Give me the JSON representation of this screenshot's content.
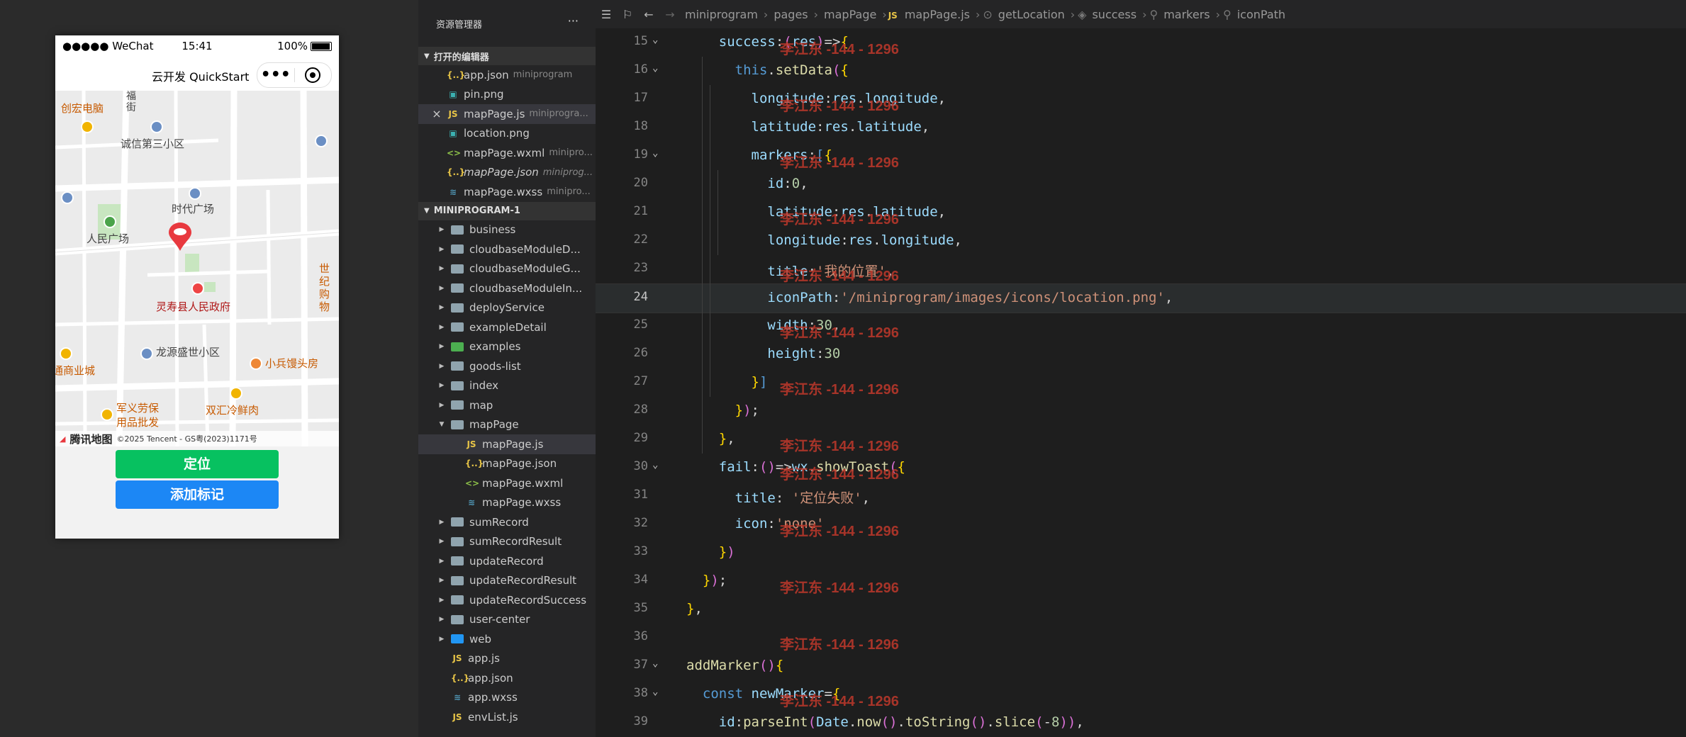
{
  "simulator": {
    "status": {
      "signal": "●●●●● WeChat",
      "time": "15:41",
      "battery": "100%"
    },
    "nav_title": "云开发 QuickStart",
    "capsule_menu": "•••",
    "map": {
      "labels": [
        "创宏电脑",
        "福街",
        "诚信第三小区",
        "时代广场",
        "人民广场",
        "灵寿县人民政府",
        "世纪购物",
        "龙源盛世小区",
        "小兵馒头房",
        "通商业城",
        "军义劳保用品批发",
        "双汇冷鲜肉"
      ],
      "provider": "腾讯地图",
      "copyright": "©2025 Tencent - GS粤(2023)1171号"
    },
    "buttons": {
      "locate": "定位",
      "add_marker": "添加标记"
    }
  },
  "explorer": {
    "title": "资源管理器",
    "more": "···",
    "open_editors_header": "打开的编辑器",
    "open_editors": [
      {
        "icon": "{..}",
        "kind": "json",
        "name": "app.json",
        "hint": "miniprogram"
      },
      {
        "icon": "▣",
        "kind": "png",
        "name": "pin.png",
        "hint": ""
      },
      {
        "icon": "JS",
        "kind": "js",
        "name": "mapPage.js",
        "hint": "miniprogra..."
      },
      {
        "icon": "▣",
        "kind": "png",
        "name": "location.png",
        "hint": ""
      },
      {
        "icon": "<>",
        "kind": "wxml",
        "name": "mapPage.wxml",
        "hint": "minipro..."
      },
      {
        "icon": "{..}",
        "kind": "json",
        "name": "mapPage.json",
        "hint": "miniprog..."
      },
      {
        "icon": "≋",
        "kind": "wxss",
        "name": "mapPage.wxss",
        "hint": "minipro..."
      }
    ],
    "project_header": "MINIPROGRAM-1",
    "tree": [
      {
        "type": "folder",
        "name": "business"
      },
      {
        "type": "folder",
        "name": "cloudbaseModuleD..."
      },
      {
        "type": "folder",
        "name": "cloudbaseModuleG..."
      },
      {
        "type": "folder",
        "name": "cloudbaseModuleIn..."
      },
      {
        "type": "folder",
        "name": "deployService"
      },
      {
        "type": "folder",
        "name": "exampleDetail"
      },
      {
        "type": "folder",
        "name": "examples"
      },
      {
        "type": "folder",
        "name": "goods-list"
      },
      {
        "type": "folder",
        "name": "index"
      },
      {
        "type": "folder",
        "name": "map"
      },
      {
        "type": "folder",
        "name": "mapPage"
      },
      {
        "type": "file",
        "icon": "JS",
        "kind": "js",
        "name": "mapPage.js"
      },
      {
        "type": "file",
        "icon": "{..}",
        "kind": "json",
        "name": "mapPage.json"
      },
      {
        "type": "file",
        "icon": "<>",
        "kind": "wxml",
        "name": "mapPage.wxml"
      },
      {
        "type": "file",
        "icon": "≋",
        "kind": "wxss",
        "name": "mapPage.wxss"
      },
      {
        "type": "folder",
        "name": "sumRecord"
      },
      {
        "type": "folder",
        "name": "sumRecordResult"
      },
      {
        "type": "folder",
        "name": "updateRecord"
      },
      {
        "type": "folder",
        "name": "updateRecordResult"
      },
      {
        "type": "folder",
        "name": "updateRecordSuccess"
      },
      {
        "type": "folder",
        "name": "user-center"
      },
      {
        "type": "folder",
        "name": "web"
      },
      {
        "type": "file",
        "icon": "JS",
        "kind": "js",
        "name": "app.js"
      },
      {
        "type": "file",
        "icon": "{..}",
        "kind": "json",
        "name": "app.json"
      },
      {
        "type": "file",
        "icon": "≋",
        "kind": "wxss",
        "name": "app.wxss"
      },
      {
        "type": "file",
        "icon": "JS",
        "kind": "js",
        "name": "envList.js"
      }
    ]
  },
  "editor": {
    "breadcrumb": [
      "miniprogram",
      "pages",
      "mapPage",
      "mapPage.js",
      "getLocation",
      "success",
      "markers",
      "iconPath"
    ],
    "watermark": "李江东 -144 - 1296",
    "current_line": 24,
    "lines": [
      {
        "n": 15,
        "code": "    success:(res)=>{"
      },
      {
        "n": 16,
        "code": "      this.setData({"
      },
      {
        "n": 17,
        "code": "        longitude:res.longitude,"
      },
      {
        "n": 18,
        "code": "        latitude:res.latitude,"
      },
      {
        "n": 19,
        "code": "        markers:[{"
      },
      {
        "n": 20,
        "code": "          id:0,"
      },
      {
        "n": 21,
        "code": "          latitude:res.latitude,"
      },
      {
        "n": 22,
        "code": "          longitude:res.longitude,"
      },
      {
        "n": 23,
        "code": "          title:'我的位置',"
      },
      {
        "n": 24,
        "code": "          iconPath:'/miniprogram/images/icons/location.png',"
      },
      {
        "n": 25,
        "code": "          width:30,"
      },
      {
        "n": 26,
        "code": "          height:30"
      },
      {
        "n": 27,
        "code": "        }]"
      },
      {
        "n": 28,
        "code": "      });"
      },
      {
        "n": 29,
        "code": "    },"
      },
      {
        "n": 30,
        "code": "    fail:()=>wx.showToast({"
      },
      {
        "n": 31,
        "code": "      title: '定位失败',"
      },
      {
        "n": 32,
        "code": "      icon:'none'"
      },
      {
        "n": 33,
        "code": "    })"
      },
      {
        "n": 34,
        "code": "  });"
      },
      {
        "n": 35,
        "code": "},"
      },
      {
        "n": 36,
        "code": ""
      },
      {
        "n": 37,
        "code": "addMarker(){"
      },
      {
        "n": 38,
        "code": "  const newMarker={"
      },
      {
        "n": 39,
        "code": "    id:parseInt(Date.now().toString().slice(-8)),"
      }
    ]
  }
}
